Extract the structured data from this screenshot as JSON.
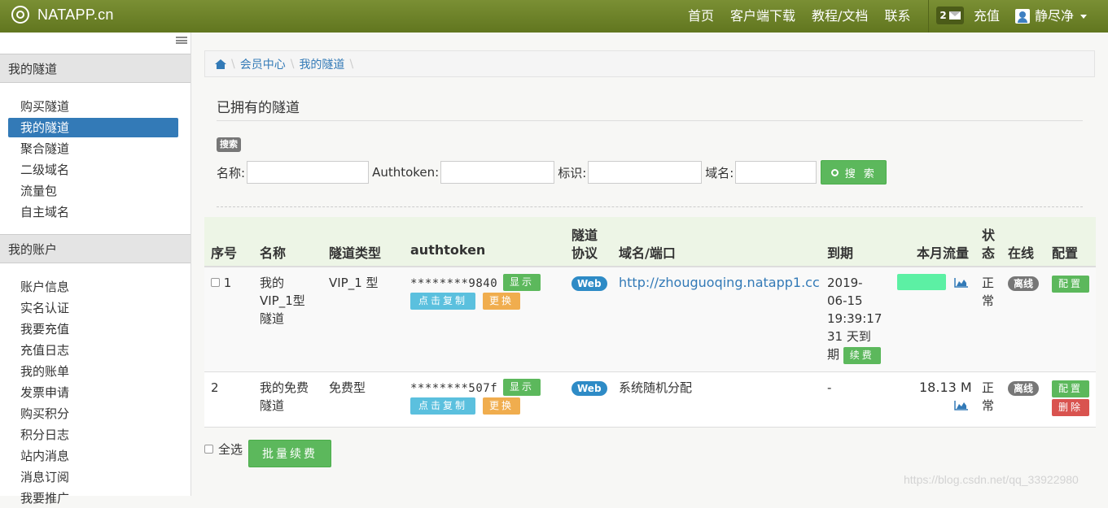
{
  "navbar": {
    "brand": "NATAPP.cn",
    "links": [
      "首页",
      "客户端下载",
      "教程/文档",
      "联系"
    ],
    "message_count": "2",
    "recharge": "充值",
    "username": "静尽净"
  },
  "sidebar": {
    "section_tunnels": "我的隧道",
    "tunnel_items": [
      "购买隧道",
      "我的隧道",
      "聚合隧道",
      "二级域名",
      "流量包",
      "自主域名"
    ],
    "section_account": "我的账户",
    "account_items": [
      "账户信息",
      "实名认证",
      "我要充值",
      "充值日志",
      "我的账单",
      "发票申请",
      "购买积分",
      "积分日志",
      "站内消息",
      "消息订阅",
      "我要推广"
    ]
  },
  "breadcrumb": [
    "会员中心",
    "我的隧道"
  ],
  "page_title": "已拥有的隧道",
  "search": {
    "badge": "搜索",
    "name_label": "名称:",
    "authtoken_label": "Authtoken:",
    "tag_label": "标识:",
    "domain_label": "域名:",
    "button": "搜 索",
    "name_value": "",
    "authtoken_value": "",
    "tag_value": "",
    "domain_value": ""
  },
  "table": {
    "headers": {
      "index": "序号",
      "name": "名称",
      "type": "隧道类型",
      "authtoken": "authtoken",
      "protocol_1": "隧道",
      "protocol_2": "协议",
      "domain": "域名/端口",
      "expire": "到期",
      "traffic": "本月流量",
      "status_1": "状",
      "status_2": "态",
      "online": "在线",
      "config": "配置"
    },
    "rows": [
      {
        "index": "1",
        "name_lines": [
          "我的",
          "VIP_1型",
          "隧道"
        ],
        "type": "VIP_1 型",
        "authtoken": "********9840",
        "show_btn": "显示",
        "copy_btn": "点击复制",
        "change_btn": "更换",
        "protocol": "Web",
        "domain": "http://zhouguoqing.natapp1.cc",
        "expire_lines": [
          "2019-",
          "06-15",
          "19:39:17",
          "31 天到",
          "期"
        ],
        "renew_btn": "续费",
        "traffic": "",
        "status_lines": [
          "正",
          "常"
        ],
        "online": "离线",
        "config_btn": "配置"
      },
      {
        "index": "2",
        "name_lines": [
          "我的免费",
          "隧道"
        ],
        "type": "免费型",
        "authtoken": "********507f",
        "show_btn": "显示",
        "copy_btn": "点击复制",
        "change_btn": "更换",
        "protocol": "Web",
        "domain": "系统随机分配",
        "expire": "-",
        "traffic": "18.13 M",
        "status_lines": [
          "正",
          "常"
        ],
        "online": "离线",
        "config_btn": "配置",
        "delete_btn": "删除"
      }
    ]
  },
  "footer": {
    "select_all": "全选",
    "batch_renew": "批量续费",
    "watermark": "https://blog.csdn.net/qq_33922980"
  },
  "colors": {
    "navbar": "#6b8028",
    "active": "#337ab7",
    "success": "#5cb85c",
    "info": "#5bc0de",
    "warning": "#f0ad4e",
    "danger": "#d9534f",
    "traffic_bar": "#5cf0a4"
  }
}
